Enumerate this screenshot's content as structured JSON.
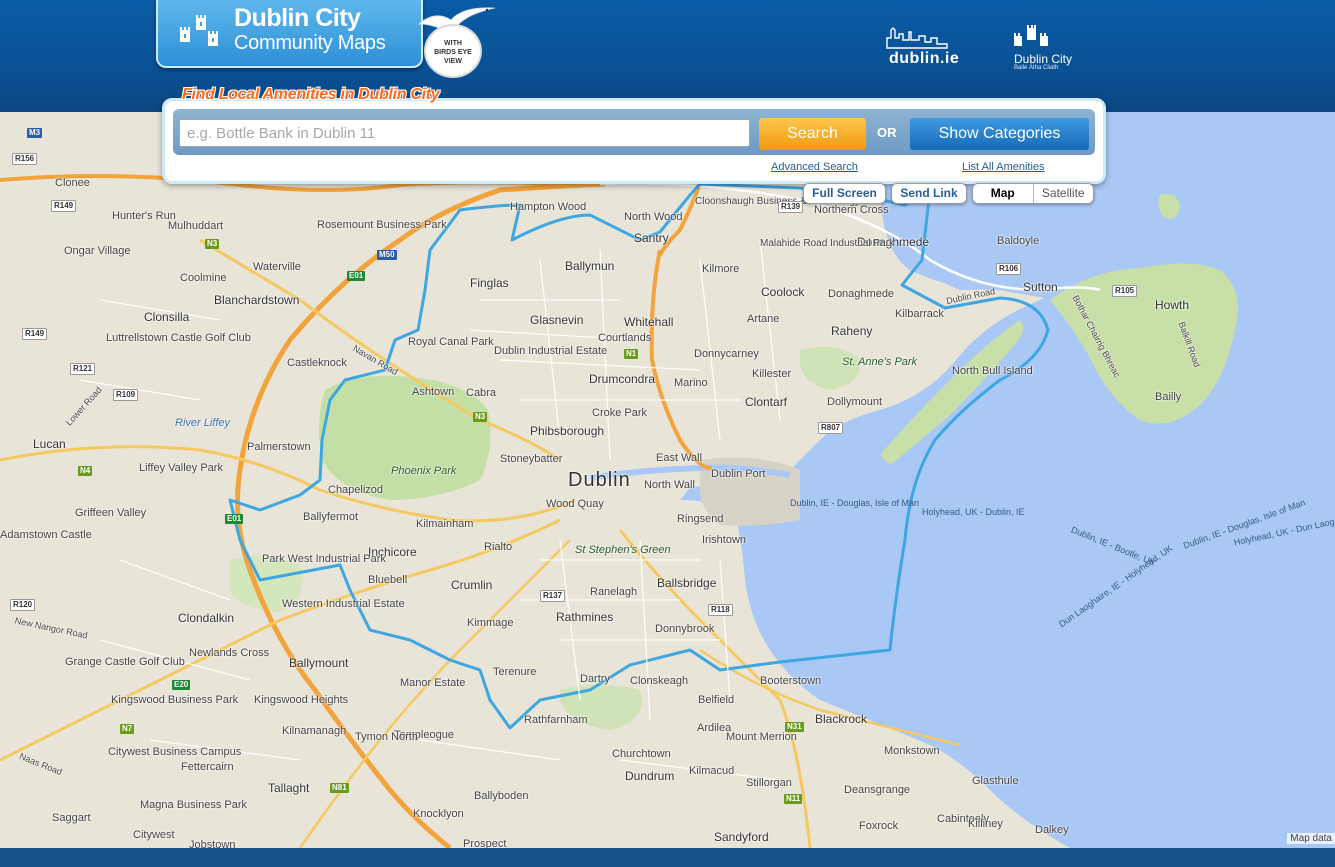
{
  "header": {
    "logo_title": "Dublin City",
    "logo_subtitle": "Community Maps",
    "badge_lines": [
      "WITH",
      "BIRDS EYE",
      "VIEW"
    ],
    "partner_dublin_ie": "dublin.ie",
    "partner_council_name": "Dublin City",
    "partner_council_irish": "Baile Átha Cliath"
  },
  "search": {
    "heading": "Find Local Amenities in Dublin City",
    "placeholder": "e.g. Bottle Bank in Dublin 11",
    "value": "",
    "search_label": "Search",
    "or_label": "OR",
    "categories_label": "Show Categories",
    "advanced_link": "Advanced Search",
    "list_all_link": "List All Amenities"
  },
  "map_controls": {
    "full_screen": "Full Screen",
    "send_link": "Send Link",
    "map": "Map",
    "satellite": "Satellite",
    "selected": "Map"
  },
  "map": {
    "attribution": "Map data",
    "colors": {
      "land": "#e8e4d8",
      "water": "#a9c8f5",
      "park": "#c4dfa6",
      "motorway": "#f3a33b",
      "boundary": "#3ea6e0"
    },
    "places": [
      "Dublin",
      "Clonee",
      "Hunter's Run",
      "Mulhuddart",
      "Ongar Village",
      "Coolmine",
      "Blanchardstown",
      "Waterville",
      "Rosemount Business Park",
      "Hampton Wood",
      "North Wood",
      "Santry",
      "Cloonshaugh Business & Technology Park",
      "Northern Cross",
      "Donaghmede",
      "Baldoyle",
      "Malahide Road Industrial Park",
      "Kilmore",
      "Coolock",
      "Donaghmede",
      "Sutton",
      "Howth",
      "Bailly",
      "Kilbarrack",
      "Raheny",
      "Artane",
      "Donnycarney",
      "Killester",
      "Clontarf",
      "Dollymount",
      "North Bull Island",
      "St. Anne's Park",
      "Finglas",
      "Ballymun",
      "Glasnevin",
      "Whitehall",
      "Courtlands",
      "Marino",
      "Drumcondra",
      "Dublin Industrial Estate",
      "Royal Canal Park",
      "Ashtown",
      "Cabra",
      "Croke Park",
      "Phibsborough",
      "Stoneybatter",
      "East Wall",
      "North Wall",
      "Dublin Port",
      "Wood Quay",
      "Ringsend",
      "Irishtown",
      "St Stephen's Green",
      "Ballsbridge",
      "Donnybrook",
      "Ranelagh",
      "Rathmines",
      "Kimmage",
      "Terenure",
      "Crumlin",
      "Rialto",
      "Kilmainham",
      "Inchicore",
      "Bluebell",
      "Chapelizod",
      "Phoenix Park",
      "Ballyfermot",
      "Palmerstown",
      "Castleknock",
      "Clonsilla",
      "Luttrellstown Castle Golf Club",
      "Lucan",
      "Liffey Valley Park",
      "Griffeen Valley",
      "Adamstown Castle",
      "Park West Industrial Park",
      "Western Industrial Estate",
      "Clondalkin",
      "Newlands Cross",
      "Grange Castle Golf Club",
      "Ballymount",
      "Kingswood Business Park",
      "Kingswood Heights",
      "Kilnamanagh",
      "Manor Estate",
      "Templeogue",
      "Tymon North",
      "Citywest Business Campus",
      "Fettercairn",
      "Tallaght",
      "Magna Business Park",
      "Saggart",
      "Citywest",
      "Jobstown",
      "Knocklyon",
      "Ballyboden",
      "Rathfarnham",
      "Dartry",
      "Clonskeagh",
      "Booterstown",
      "Belfield",
      "Ardilea",
      "Mount Merrion",
      "Churchtown",
      "Dundrum",
      "Kilmacud",
      "Stillorgan",
      "Blackrock",
      "Monkstown",
      "Glasthule",
      "Deansgrange",
      "Sandyford",
      "Foxrock",
      "Cabinteely",
      "Killiney",
      "Dalkey",
      "Prospect",
      "Lower Road",
      "River Liffey",
      "Navan Road",
      "New Nangor Road",
      "Naas Road",
      "Dublin Road",
      "Bothar Chairrig Bhreac",
      "Balkill Road"
    ],
    "ferry_routes": [
      "Dublin, IE - Douglas, Isle of Man",
      "Holyhead, UK - Dublin, IE",
      "Dublin, IE - Bootle, UK",
      "Dublin, IE - Douglas, Isle of Man",
      "Holyhead, UK - Dun Laog",
      "Dun Laoghaire, IE - Holyhead, UK"
    ],
    "road_shields": [
      "M3",
      "R156",
      "R149",
      "N3",
      "E01",
      "M50",
      "R149",
      "R121",
      "R109",
      "N4",
      "R120",
      "E20",
      "N7",
      "N81",
      "R139",
      "R106",
      "R105",
      "R807",
      "N1",
      "N3",
      "R137",
      "R118",
      "N31",
      "N11",
      "E01"
    ]
  }
}
